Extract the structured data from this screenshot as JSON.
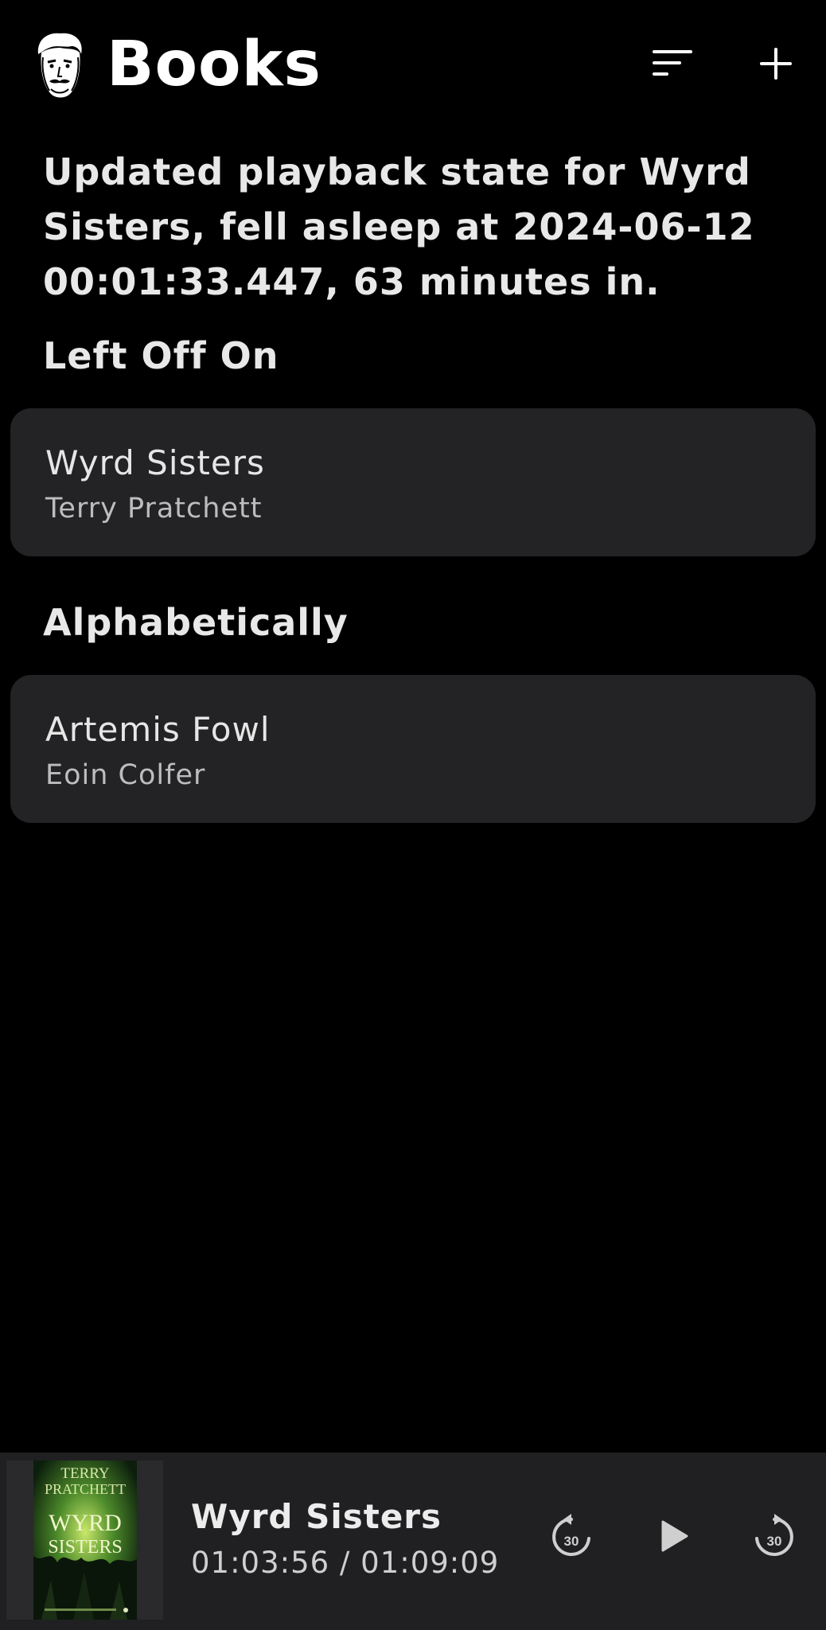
{
  "header": {
    "title": "Books",
    "logo_icon": "face-sketch-icon",
    "sort_icon": "sort-lines-icon",
    "add_icon": "plus-icon"
  },
  "status_message": "Updated playback state for Wyrd Sisters, fell asleep at 2024-06-12 00:01:33.447, 63 minutes in.",
  "sections": {
    "left_off_on": {
      "heading": "Left Off On",
      "books": [
        {
          "title": "Wyrd Sisters",
          "author": "Terry Pratchett"
        }
      ]
    },
    "alphabetically": {
      "heading": "Alphabetically",
      "books": [
        {
          "title": "Artemis Fowl",
          "author": "Eoin Colfer"
        }
      ]
    }
  },
  "now_playing": {
    "title": "Wyrd Sisters",
    "time": "01:03:56 / 01:09:09",
    "cover": {
      "author_line1": "TERRY",
      "author_line2": "PRATCHETT",
      "title_line1": "WYRD",
      "title_line2": "SISTERS"
    },
    "skip_back_seconds": "30",
    "skip_forward_seconds": "30",
    "rewind_icon": "rewind-30-icon",
    "play_icon": "play-icon",
    "forward_icon": "forward-30-icon"
  },
  "colors": {
    "background": "#000000",
    "card": "#232325",
    "player_bar": "#202022",
    "text": "#e6e6e6"
  }
}
